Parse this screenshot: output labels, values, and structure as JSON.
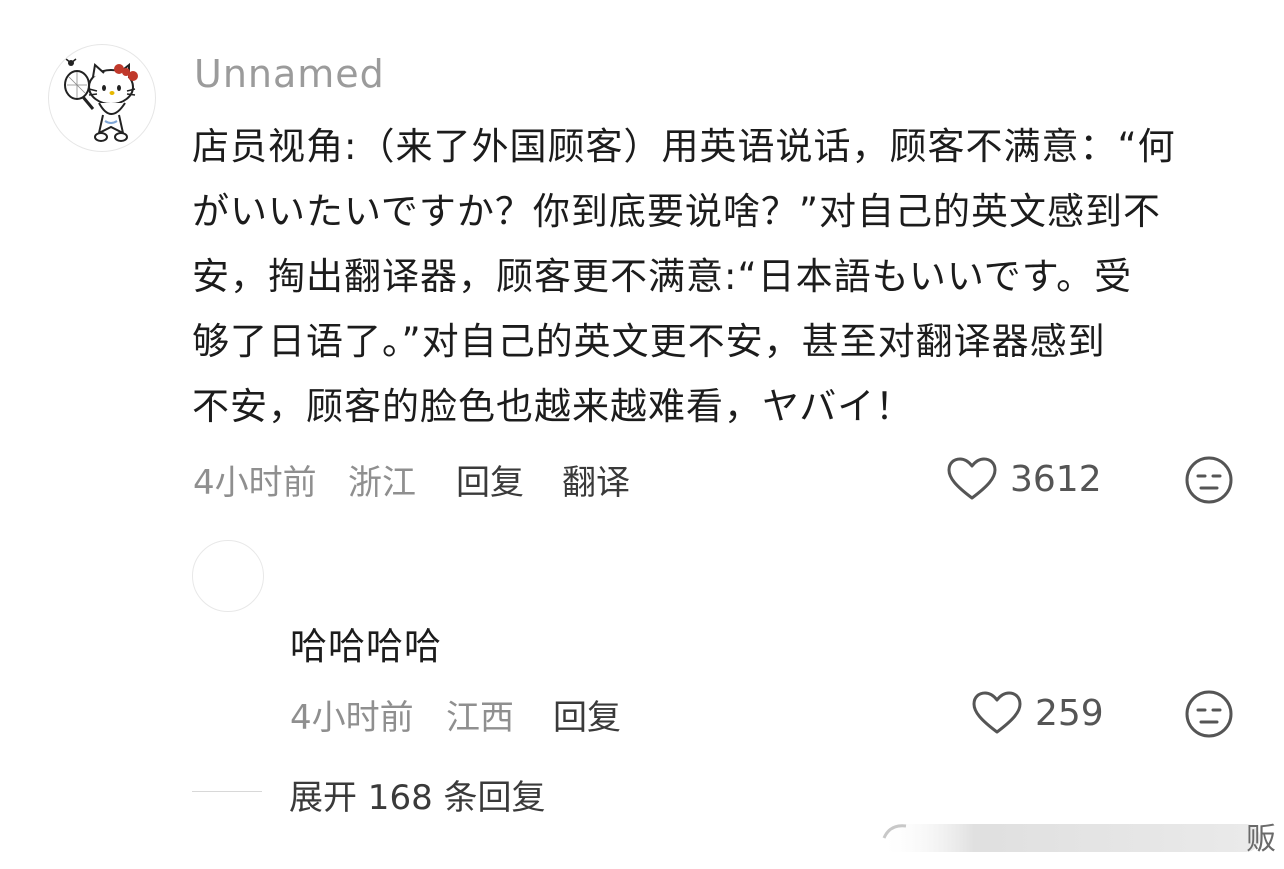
{
  "comment": {
    "username": "Unnamed",
    "text": "店员视角:（来了外国顾客）用英语说话，顾客不满意：“何\nがいいたいですか？你到底要说啥？”对自己的英文感到不\n安，掏出翻译器，顾客更不满意:“日本語もいいです。受\n够了日语了。”对自己的英文更不安，甚至对翻译器感到\n不安，顾客的脸色也越来越难看，ヤバイ！",
    "time": "4小时前",
    "location": "浙江",
    "reply_label": "回复",
    "translate_label": "翻译",
    "like_count": "3612",
    "like_icon": "heart-outline-icon",
    "reaction_icon": "meh-face-icon"
  },
  "reply": {
    "text": "哈哈哈哈",
    "time": "4小时前",
    "location": "江西",
    "reply_label": "回复",
    "like_count": "259",
    "like_icon": "heart-outline-icon",
    "reaction_icon": "meh-face-icon"
  },
  "expand": {
    "label": "展开 168 条回复"
  },
  "watermark": {
    "char": "贩"
  },
  "colors": {
    "username": "#9b9b9b",
    "text": "#1c1c1c",
    "meta": "#8f8f8f",
    "action": "#3a3a3a",
    "background": "#ffffff"
  }
}
